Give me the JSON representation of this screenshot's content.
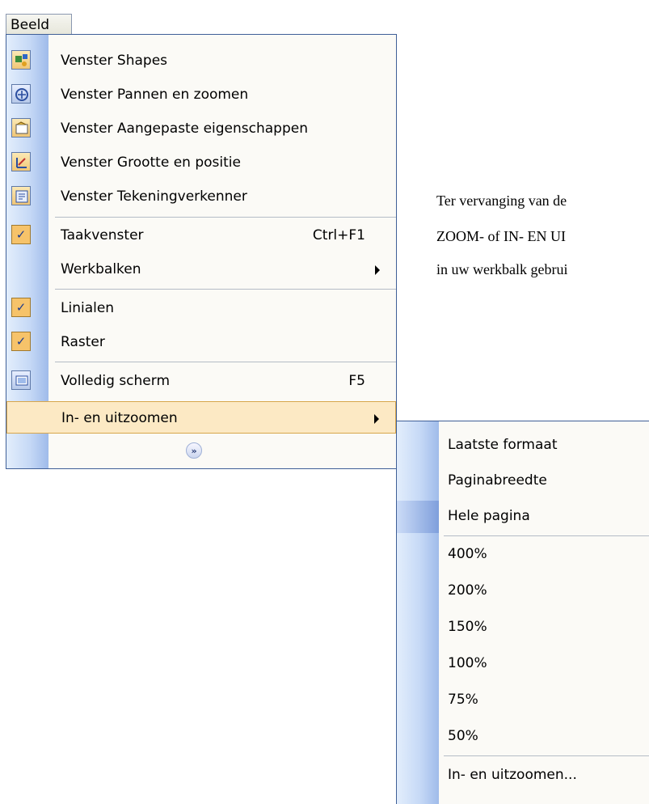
{
  "menu_title": "Beeld",
  "menu_items": [
    {
      "label": "Venster Shapes",
      "icon": "shapes-window-icon"
    },
    {
      "label": "Venster Pannen en zoomen",
      "icon": "pan-zoom-window-icon"
    },
    {
      "label": "Venster Aangepaste eigenschappen",
      "icon": "custom-properties-window-icon"
    },
    {
      "label": "Venster Grootte en positie",
      "icon": "size-position-window-icon"
    },
    {
      "label": "Venster Tekeningverkenner",
      "icon": "drawing-explorer-window-icon"
    },
    {
      "label": "Taakvenster",
      "shortcut": "Ctrl+F1",
      "checked": true
    },
    {
      "label": "Werkbalken",
      "submenu": true
    },
    {
      "label": "Linialen",
      "checked": true
    },
    {
      "label": "Raster",
      "checked": true
    },
    {
      "label": "Volledig scherm",
      "shortcut": "F5",
      "icon": "full-screen-icon"
    },
    {
      "label": "In- en uitzoomen",
      "submenu": true,
      "highlighted": true
    }
  ],
  "submenu_items": [
    "Laatste formaat",
    "Paginabreedte",
    "Hele pagina",
    "400%",
    "200%",
    "150%",
    "100%",
    "75%",
    "50%",
    "In- en uitzoomen..."
  ],
  "body_text": [
    "Ter vervanging van de",
    "ZOOM- of IN- EN UI",
    "in uw werkbalk gebrui"
  ],
  "colors": {
    "menu_border": "#3f5f97",
    "gutter": "#c6d9f6",
    "highlight": "#fce9c4",
    "check_box": "#f6c36a"
  }
}
